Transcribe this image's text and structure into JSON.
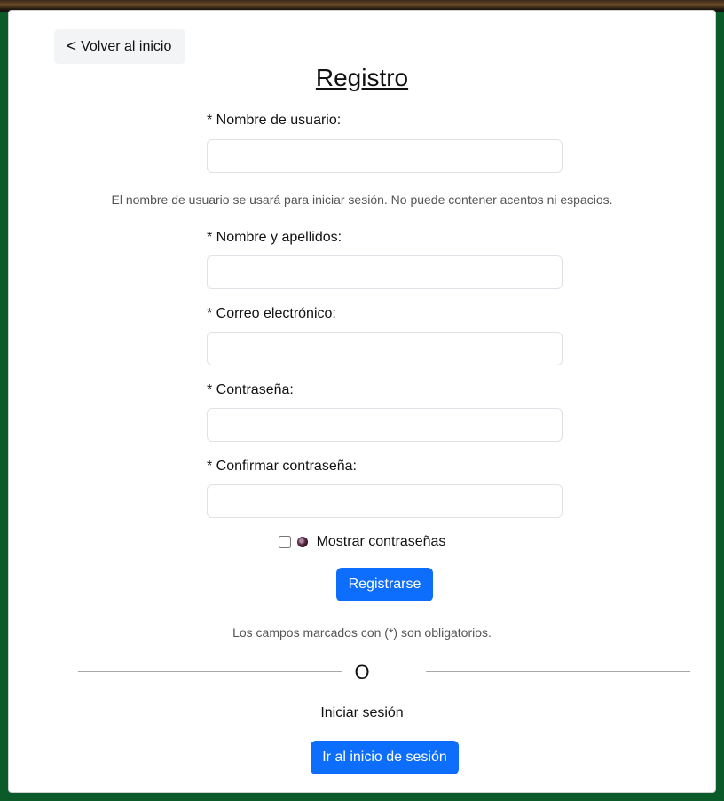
{
  "back_button": {
    "label": "Volver al inicio",
    "icon": "chevron-left-icon"
  },
  "title": "Registro",
  "fields": {
    "username": {
      "label": "* Nombre de usuario:",
      "value": "",
      "placeholder": ""
    },
    "fullname": {
      "label": "* Nombre y apellidos:",
      "value": "",
      "placeholder": ""
    },
    "email": {
      "label": "* Correo electrónico:",
      "value": "",
      "placeholder": ""
    },
    "password": {
      "label": "* Contraseña:",
      "value": "",
      "placeholder": ""
    },
    "confirm_password": {
      "label": "* Confirmar contraseña:",
      "value": "",
      "placeholder": ""
    }
  },
  "username_help": "El nombre de usuario se usará para iniciar sesión. No puede contener acentos ni espacios.",
  "show_passwords": {
    "label": "Mostrar contraseñas",
    "checked": false,
    "icon": "eye-icon"
  },
  "register_button": "Registrarse",
  "required_note": "Los campos marcados con (*) son obligatorios.",
  "divider_text": "O",
  "login_section": {
    "heading": "Iniciar sesión",
    "button": "Ir al inicio de sesión"
  },
  "colors": {
    "primary": "#0d6efd",
    "page_background": "#0b5a2a",
    "card_background": "#ffffff"
  }
}
